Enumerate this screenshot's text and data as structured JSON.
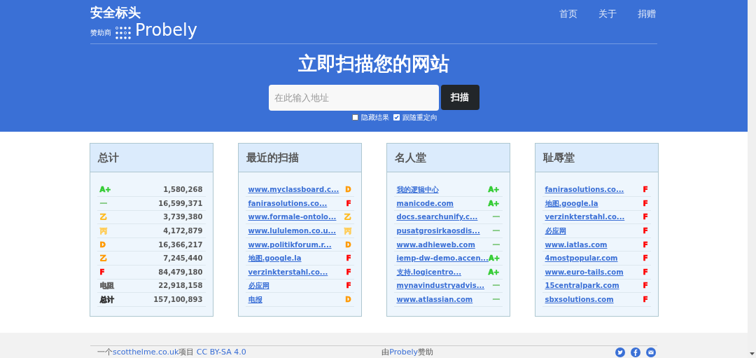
{
  "header": {
    "title": "安全标头",
    "sponsor_label": "赞助商",
    "sponsor_name": "Probely",
    "nav": [
      "首页",
      "关于",
      "捐赠"
    ]
  },
  "hero": {
    "heading": "立即扫描您的网站",
    "placeholder": "在此输入地址",
    "button": "扫描",
    "options": [
      {
        "label": "隐藏结果",
        "checked": false
      },
      {
        "label": "跟随重定向",
        "checked": true
      }
    ]
  },
  "panels": [
    {
      "title": "总计",
      "kind": "stats",
      "rows": [
        {
          "grade": "A+",
          "color": "#33cc33",
          "value": "1,580,268"
        },
        {
          "grade": "一",
          "color": "#88cc88",
          "value": "16,599,371"
        },
        {
          "grade": "乙",
          "color": "#ffbb22",
          "value": "3,739,380"
        },
        {
          "grade": "丙",
          "color": "#ffcc55",
          "value": "4,172,879"
        },
        {
          "grade": "D",
          "color": "#ff9900",
          "value": "16,366,217"
        },
        {
          "grade": "乙",
          "color": "#ff9900",
          "value": "7,245,440"
        },
        {
          "grade": "F",
          "color": "#ff0000",
          "value": "84,479,180"
        },
        {
          "grade": "电阻",
          "color": "#666666",
          "value": "22,918,158"
        },
        {
          "grade": "总计",
          "color": "#333333",
          "value": "157,100,893"
        }
      ]
    },
    {
      "title": "最近的扫描",
      "kind": "links",
      "rows": [
        {
          "site": "www.myclassboard.c...",
          "grade": "D",
          "color": "#ff9900"
        },
        {
          "site": "fanirasolutions.co...",
          "grade": "F",
          "color": "#ff0000"
        },
        {
          "site": "www.formale-ontolo...",
          "grade": "乙",
          "color": "#ffbb22"
        },
        {
          "site": "www.lululemon.co.u...",
          "grade": "丙",
          "color": "#ffcc55"
        },
        {
          "site": "www.politikforum.r...",
          "grade": "D",
          "color": "#ff9900"
        },
        {
          "site": "地图.google.la",
          "grade": "F",
          "color": "#ff0000"
        },
        {
          "site": "verzinkterstahl.co...",
          "grade": "F",
          "color": "#ff0000"
        },
        {
          "site": "必应网",
          "grade": "F",
          "color": "#ff0000"
        },
        {
          "site": "电报",
          "grade": "D",
          "color": "#ff9900"
        }
      ]
    },
    {
      "title": "名人堂",
      "kind": "links",
      "rows": [
        {
          "site": "我的逻辑中心",
          "grade": "A+",
          "color": "#33cc33"
        },
        {
          "site": "manicode.com",
          "grade": "A+",
          "color": "#33cc33"
        },
        {
          "site": "docs.searchunify.c...",
          "grade": "一",
          "color": "#88cc88"
        },
        {
          "site": "pusatgrosirkaosdis...",
          "grade": "一",
          "color": "#88cc88"
        },
        {
          "site": "www.adhieweb.com",
          "grade": "一",
          "color": "#88cc88"
        },
        {
          "site": "iemp-dw-demo.accen...",
          "grade": "A+",
          "color": "#33cc33"
        },
        {
          "site": "支持.logicentro...",
          "grade": "A+",
          "color": "#33cc33"
        },
        {
          "site": "mynavindustryadvis...",
          "grade": "一",
          "color": "#88cc88"
        },
        {
          "site": "www.atlassian.com",
          "grade": "一",
          "color": "#88cc88"
        }
      ]
    },
    {
      "title": "耻辱堂",
      "kind": "links",
      "rows": [
        {
          "site": "fanirasolutions.co...",
          "grade": "F",
          "color": "#ff0000"
        },
        {
          "site": "地图.google.la",
          "grade": "F",
          "color": "#ff0000"
        },
        {
          "site": "verzinkterstahl.co...",
          "grade": "F",
          "color": "#ff0000"
        },
        {
          "site": "必应网",
          "grade": "F",
          "color": "#ff0000"
        },
        {
          "site": "www.iatlas.com",
          "grade": "F",
          "color": "#ff0000"
        },
        {
          "site": "4mostpopular.com",
          "grade": "F",
          "color": "#ff0000"
        },
        {
          "site": "www.euro-tails.com",
          "grade": "F",
          "color": "#ff0000"
        },
        {
          "site": "15centralpark.com",
          "grade": "F",
          "color": "#ff0000"
        },
        {
          "site": "sbxsolutions.com",
          "grade": "F",
          "color": "#ff0000"
        }
      ]
    }
  ],
  "footer": {
    "project_prefix": "一个",
    "project_link": "scotthelme.co.uk",
    "project_suffix": "项目",
    "license": "CC BY-SA 4.0",
    "sponsor_prefix": "由",
    "sponsor_link": "Probely",
    "sponsor_suffix": "赞助"
  }
}
